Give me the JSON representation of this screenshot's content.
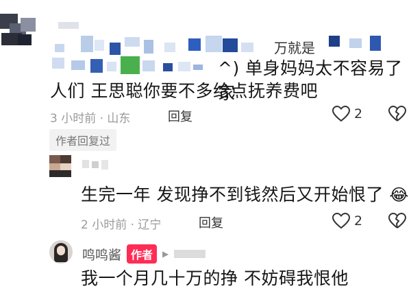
{
  "comment1": {
    "text_line1": "^) 单身妈妈太不容易了家",
    "text_line2": "人们 王思聪你要不多给点抚养费吧",
    "meta": "3 小时前 · 山东",
    "reply_label": "回复",
    "like_count": "2",
    "author_replied_tag": "作者回复过",
    "partial_text": "万就是"
  },
  "comment2": {
    "text": "生完一年 发现挣不到钱然后又开始恨了",
    "emoji": "😂",
    "meta": "2 小时前 · 辽宁",
    "reply_label": "回复",
    "like_count": "2"
  },
  "comment3": {
    "username": "鸣鸣酱",
    "author_badge": "作者",
    "text": "我一个月几十万的挣 不妨碍我恨他"
  },
  "colors": {
    "author_badge": "#ff2d55",
    "meta_gray": "#9a9a9a",
    "tag_bg": "#f2f2f2"
  }
}
